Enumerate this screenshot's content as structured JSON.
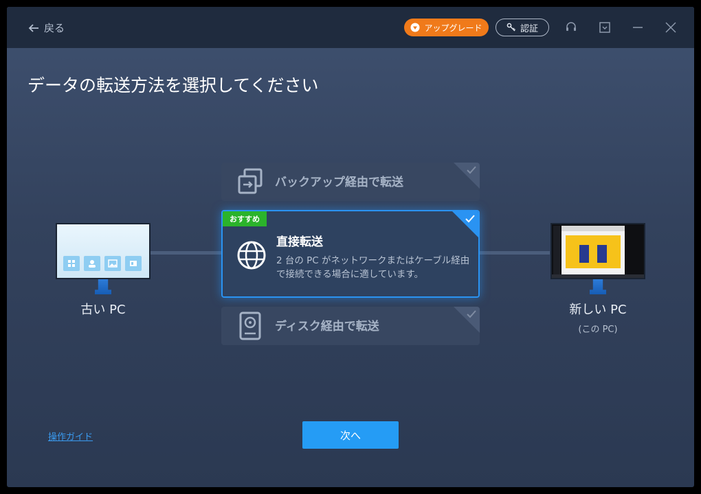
{
  "titlebar": {
    "back_label": "戻る",
    "upgrade_label": "アップグレード",
    "auth_label": "認証"
  },
  "heading": "データの転送方法を選択してください",
  "old_pc": {
    "label": "古い PC"
  },
  "new_pc": {
    "label": "新しい PC",
    "sublabel": "(この PC)"
  },
  "options": {
    "backup": {
      "title": "バックアップ経由で転送"
    },
    "direct": {
      "badge": "おすすめ",
      "title": "直接転送",
      "description": "2 台の PC がネットワークまたはケーブル経由で接続できる場合に適しています。"
    },
    "disk": {
      "title": "ディスク経由で転送"
    }
  },
  "footer": {
    "guide_link": "操作ガイド",
    "next_label": "次へ"
  },
  "colors": {
    "accent": "#259cf5",
    "upgrade": "#f07a1a",
    "recommend": "#2bb32b"
  }
}
